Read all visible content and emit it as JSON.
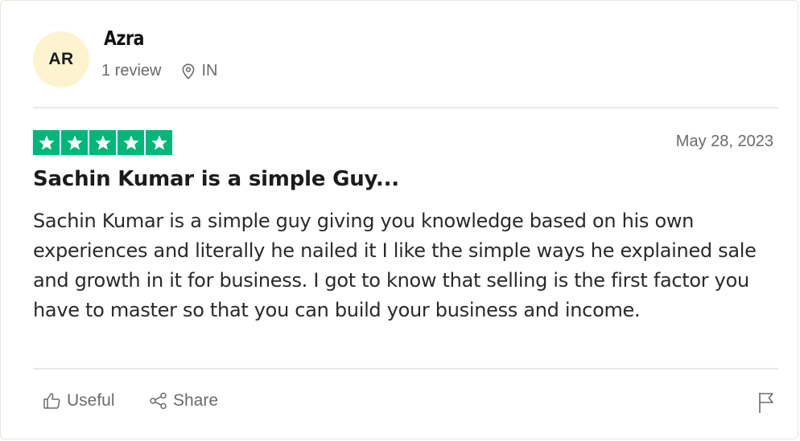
{
  "reviewer": {
    "initials": "AR",
    "name": "Azra",
    "review_count": "1 review",
    "country": "IN"
  },
  "review": {
    "rating": 5,
    "date": "May 28, 2023",
    "title": "Sachin Kumar is a simple Guy...",
    "body": "Sachin Kumar is a simple guy giving you knowledge based on his own experiences and literally he nailed it I like the simple ways he explained sale and growth in it for business. I got to know that selling is the first factor you have to master so that you can build your business and income."
  },
  "actions": {
    "useful_label": "Useful",
    "share_label": "Share"
  },
  "colors": {
    "star_green": "#00b67a",
    "avatar_bg": "#fdf4cf"
  },
  "icons": {
    "location": "location-pin-icon",
    "useful": "thumbs-up-icon",
    "share": "share-icon",
    "report": "flag-icon",
    "star": "star-icon"
  }
}
